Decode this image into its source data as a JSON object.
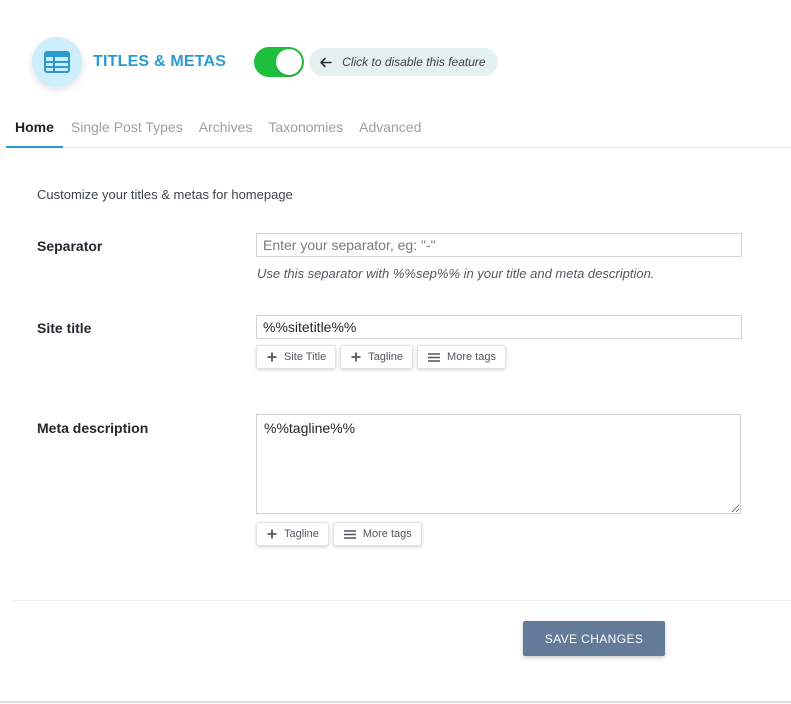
{
  "header": {
    "title": "TITLES & METAS",
    "logo_icon": "table-icon",
    "toggle_on": true,
    "hint": "Click to disable this feature"
  },
  "tabs": [
    {
      "label": "Home",
      "active": true
    },
    {
      "label": "Single Post Types",
      "active": false
    },
    {
      "label": "Archives",
      "active": false
    },
    {
      "label": "Taxonomies",
      "active": false
    },
    {
      "label": "Advanced",
      "active": false
    }
  ],
  "intro": "Customize your titles & metas for homepage",
  "separator": {
    "label": "Separator",
    "value": "",
    "placeholder": "Enter your separator, eg: \"-\"",
    "help": "Use this separator with %%sep%% in your title and meta description."
  },
  "site_title": {
    "label": "Site title",
    "value": "%%sitetitle%%",
    "tags": [
      {
        "label": "Site Title",
        "icon": "plus-icon"
      },
      {
        "label": "Tagline",
        "icon": "plus-icon"
      },
      {
        "label": "More tags",
        "icon": "menu-icon"
      }
    ]
  },
  "meta_description": {
    "label": "Meta description",
    "value": "%%tagline%%",
    "tags": [
      {
        "label": "Tagline",
        "icon": "plus-icon"
      },
      {
        "label": "More tags",
        "icon": "menu-icon"
      }
    ]
  },
  "save_label": "SAVE CHANGES",
  "colors": {
    "accent": "#2b9ad1",
    "toggle_on": "#1fbf3e",
    "save_button": "#637a98"
  }
}
